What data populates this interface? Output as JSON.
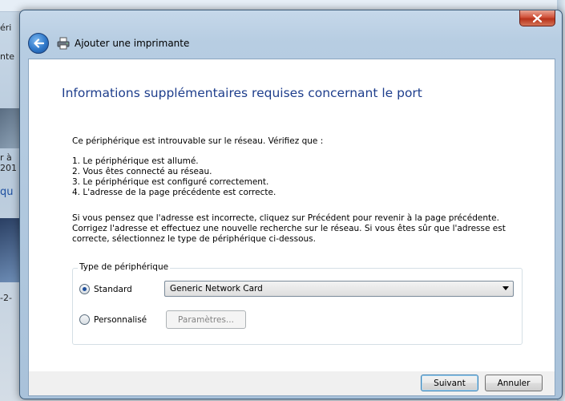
{
  "background": {
    "fragments": [
      "éri",
      "nte",
      "r à",
      "201",
      "qu",
      "-2-"
    ]
  },
  "dialog": {
    "title": "Ajouter une imprimante",
    "heading": "Informations supplémentaires requises concernant le port",
    "intro": "Ce périphérique est introuvable sur le réseau. Vérifiez que :",
    "checklist": [
      "1. Le périphérique est allumé.",
      "2. Vous êtes connecté au réseau.",
      "3. Le périphérique est configuré correctement.",
      "4. L'adresse de la page précédente est correcte."
    ],
    "instructions": [
      "Si vous pensez que l'adresse est incorrecte, cliquez sur Précédent pour revenir à la page précédente.",
      "Corrigez l'adresse et effectuez une nouvelle recherche sur le réseau. Si vous êtes sûr que l'adresse est",
      "correcte, sélectionnez le type de périphérique ci-dessous."
    ],
    "device_group": {
      "legend": "Type de périphérique",
      "standard_label": "Standard",
      "standard_selected": true,
      "selected_device": "Generic Network Card",
      "custom_label": "Personnalisé",
      "params_button": "Paramètres..."
    },
    "footer": {
      "next_label": "Suivant",
      "cancel_label": "Annuler"
    }
  },
  "icons": {
    "close": "close-icon",
    "back": "back-arrow-icon",
    "printer": "printer-icon",
    "dropdown": "chevron-down-icon"
  }
}
